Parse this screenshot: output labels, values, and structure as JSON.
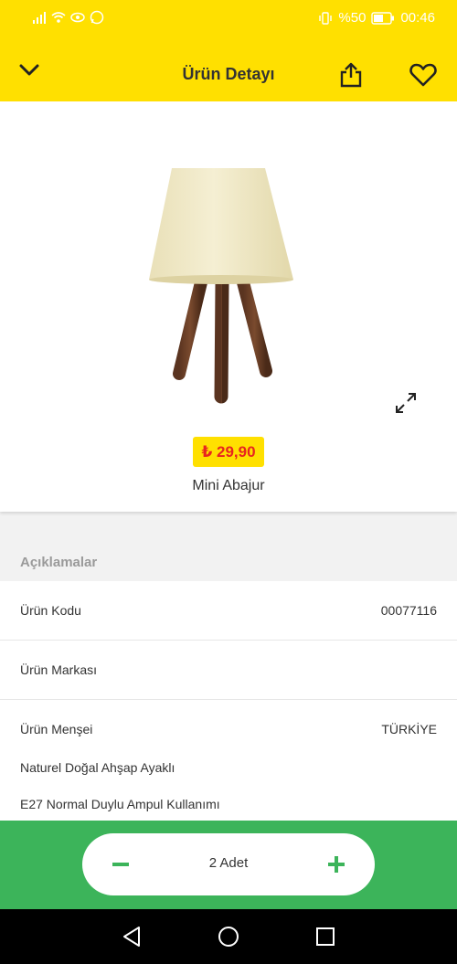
{
  "status_bar": {
    "battery_text": "%50",
    "time": "00:46"
  },
  "header": {
    "title": "Ürün Detayı",
    "icons": [
      "chevron-down-icon",
      "share-icon",
      "heart-icon"
    ]
  },
  "product": {
    "price": "₺ 29,90",
    "name": "Mini Abajur"
  },
  "details": {
    "section_title": "Açıklamalar",
    "rows": [
      {
        "label": "Ürün Kodu",
        "value": "00077116"
      },
      {
        "label": "Ürün Markası",
        "value": ""
      },
      {
        "label": "Ürün Menşei",
        "value": "TÜRKİYE"
      }
    ],
    "description_lines": [
      "Naturel Doğal Ahşap Ayaklı",
      "E27 Normal Duylu Ampul Kullanımı"
    ]
  },
  "quantity": {
    "label": "2 Adet"
  },
  "colors": {
    "header_bg": "#ffe000",
    "bottom_bar_bg": "#3cb45a",
    "price_text": "#e8251f",
    "price_bg": "#ffe000"
  }
}
